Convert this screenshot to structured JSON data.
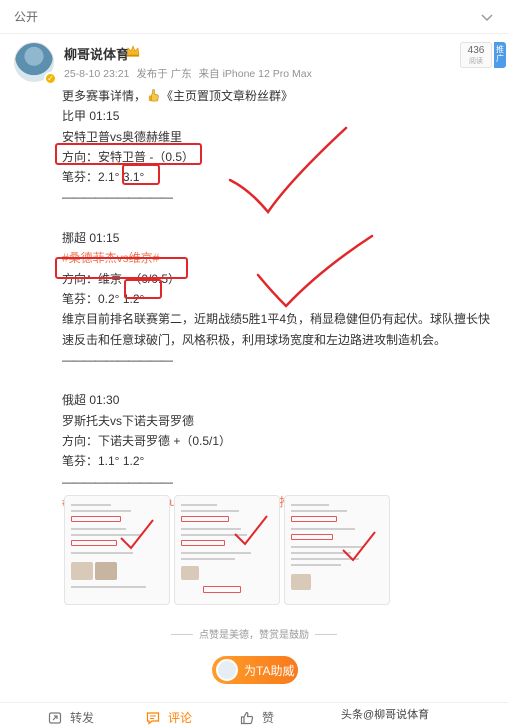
{
  "topbar": {
    "visibility": "公开"
  },
  "header": {
    "username": "柳哥说体育",
    "meta": {
      "timestamp": "25-8-10 23:21",
      "published_from": "发布于 广东",
      "device": "来自 iPhone 12 Pro Max"
    },
    "reads": {
      "count": "436",
      "label": "阅读"
    },
    "promote_label": "推广"
  },
  "post": {
    "intro_prefix": "更多赛事详情，",
    "intro_suffix": "《主页置顶文章粉丝群》",
    "match1": {
      "league_time": "比甲 01:15",
      "teams": "安特卫普vs奥德赫维里",
      "direction": "方向：安特卫普 -（0.5）",
      "note": "笔芬：2.1°  3.1°"
    },
    "match2": {
      "league_time": "挪超 01:15",
      "topic": "#桑德菲杰vs维京#",
      "direction": "方向：维京 -（0/0.5）",
      "note": "笔芬：0.2°  1.2°",
      "analysis": "维京目前排名联赛第二，近期战绩5胜1平4负，稍显稳健但仍有起伏。球队擅长快速反击和任意球破门，风格积极，利用球场宽度和左边路进攻制造机会。"
    },
    "match3": {
      "league_time": "俄超 01:30",
      "teams": "罗斯托夫vs下诺夫哥罗德",
      "direction": "方向：下诺夫哥罗德 +（0.5/1）",
      "note": "笔芬：1.1°  1.2°"
    },
    "divider": "——————————",
    "hashtags": "#足球预测##体育vplus开课了##每日足球推荐#"
  },
  "hint_text": "点赞是美德，赞赏是鼓励",
  "boost_label": "为TA助威",
  "actions": {
    "repost": "转发",
    "comment": "评论",
    "like": "赞"
  },
  "watermark": "头条@柳哥说体育",
  "colors": {
    "accent_orange": "#ff8200",
    "topic": "#eb7350",
    "annotation_red": "#e0282b"
  }
}
